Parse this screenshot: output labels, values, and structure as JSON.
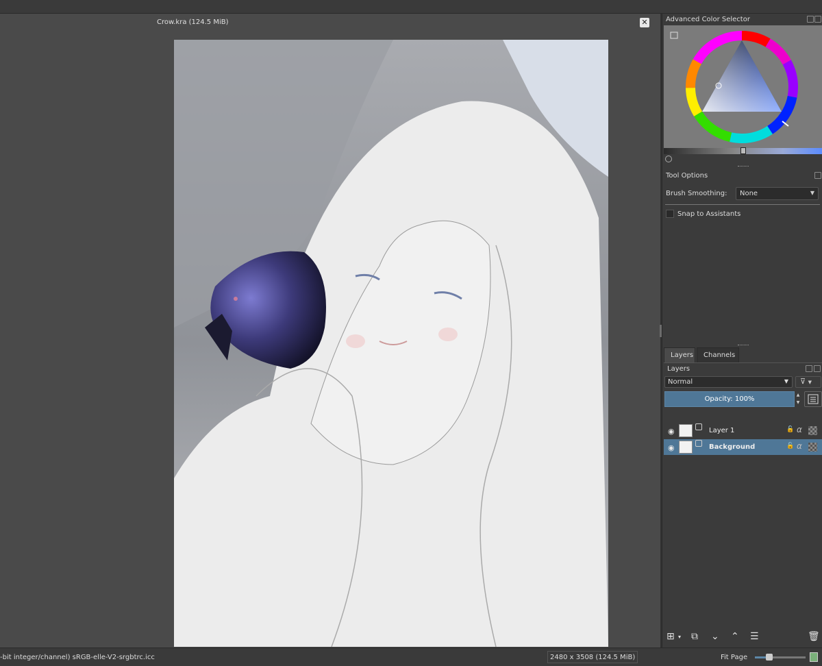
{
  "document": {
    "title": "Crow.kra (124.5 MiB)",
    "close_glyph": "✕"
  },
  "color_selector": {
    "title": "Advanced Color Selector"
  },
  "tool_options": {
    "title": "Tool Options",
    "brush_smoothing_label": "Brush Smoothing:",
    "brush_smoothing_value": "None",
    "snap_label": "Snap to Assistants"
  },
  "layers": {
    "tabs": [
      "Layers",
      "Channels"
    ],
    "title": "Layers",
    "blend_mode": "Normal",
    "opacity_label": "Opacity:  100%",
    "items": [
      {
        "name": "Layer 1",
        "selected": false
      },
      {
        "name": "Background",
        "selected": true
      }
    ]
  },
  "status": {
    "profile": "-bit integer/channel)  sRGB-elle-V2-srgbtrc.icc",
    "dimensions": "2480 x 3508 (124.5 MiB)",
    "zoom_label": "Fit Page"
  },
  "icons": {
    "eye": "eye-icon",
    "lock": "lock-icon",
    "alpha": "alpha-lock-icon",
    "add": "add-layer-icon",
    "duplicate": "duplicate-layer-icon",
    "move_down": "move-down-icon",
    "move_up": "move-up-icon",
    "properties": "layer-properties-icon",
    "delete": "trash-icon"
  },
  "colors": {
    "accent": "#4f7797",
    "dock_bg": "#3b3b3b",
    "canvas_bg": "#4a4a4a"
  }
}
